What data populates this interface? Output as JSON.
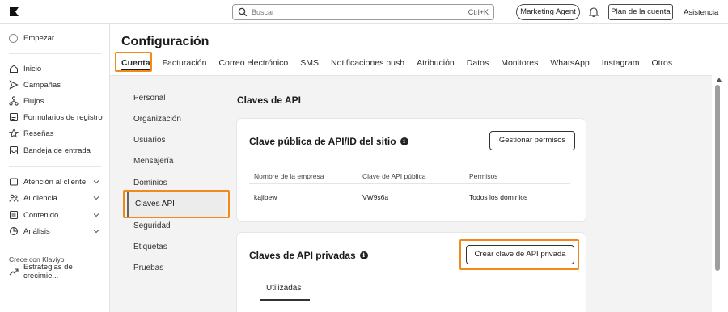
{
  "topbar": {
    "search_placeholder": "Buscar",
    "search_shortcut": "Ctrl+K",
    "marketing_agent": "Marketing Agent",
    "plan_button": "Plan de la cuenta",
    "help": "Asistencia"
  },
  "sidebar": {
    "start": "Empezar",
    "items": [
      {
        "label": "Inicio",
        "icon": "home-icon"
      },
      {
        "label": "Campañas",
        "icon": "send-icon"
      },
      {
        "label": "Flujos",
        "icon": "flow-icon"
      },
      {
        "label": "Formularios de registro",
        "icon": "form-icon"
      },
      {
        "label": "Reseñas",
        "icon": "star-icon"
      },
      {
        "label": "Bandeja de entrada",
        "icon": "inbox-icon"
      }
    ],
    "groups": [
      {
        "label": "Atención al cliente",
        "icon": "support-icon"
      },
      {
        "label": "Audiencia",
        "icon": "audience-icon"
      },
      {
        "label": "Contenido",
        "icon": "content-icon"
      },
      {
        "label": "Análisis",
        "icon": "analytics-icon"
      }
    ],
    "grow_label": "Crece con Klaviyo",
    "strategies": "Estrategias de crecimie..."
  },
  "main": {
    "title": "Configuración",
    "tabs": [
      "Cuenta",
      "Facturación",
      "Correo electrónico",
      "SMS",
      "Notificaciones push",
      "Atribución",
      "Datos",
      "Monitores",
      "WhatsApp",
      "Instagram",
      "Otros"
    ],
    "active_tab": "Cuenta"
  },
  "subnav": [
    "Personal",
    "Organización",
    "Usuarios",
    "Mensajería",
    "Dominios",
    "Claves API",
    "Seguridad",
    "Etiquetas",
    "Pruebas"
  ],
  "subnav_active": "Claves API",
  "section_title": "Claves de API",
  "public_card": {
    "title": "Clave pública de API/ID del sitio",
    "button": "Gestionar permisos",
    "headers": [
      "Nombre de la empresa",
      "Clave de API pública",
      "Permisos"
    ],
    "row": [
      "kajibew",
      "VW9s6a",
      "Todos los dominios"
    ]
  },
  "private_card": {
    "title": "Claves de API privadas",
    "button": "Crear clave de API privada",
    "tab": "Utilizadas"
  },
  "colors": {
    "highlight": "#f08a1c"
  }
}
